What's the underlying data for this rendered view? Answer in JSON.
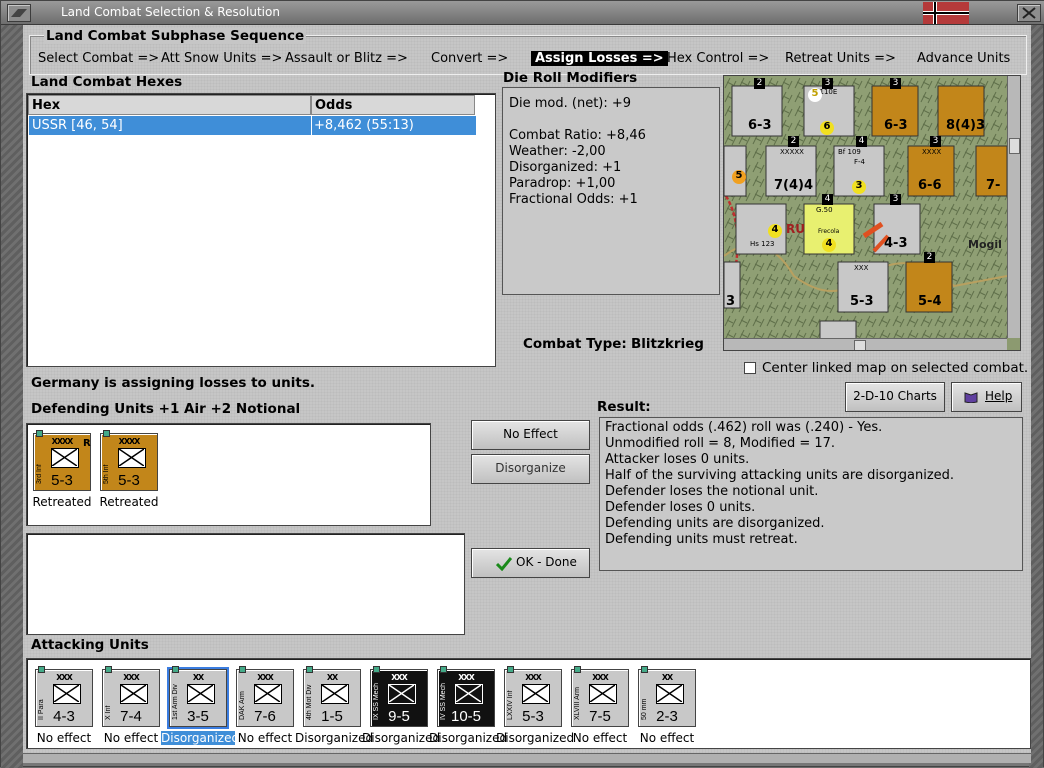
{
  "window": {
    "title": "Land Combat Selection & Resolution"
  },
  "sequence": {
    "title": "Land Combat Subphase Sequence",
    "steps": [
      {
        "label": "Select Combat =>"
      },
      {
        "label": "Att Snow Units =>"
      },
      {
        "label": "Assault or Blitz =>"
      },
      {
        "label": "Convert =>"
      },
      {
        "label": "Assign Losses =>"
      },
      {
        "label": "Hex Control =>"
      },
      {
        "label": "Retreat Units =>"
      },
      {
        "label": "Advance Units"
      }
    ]
  },
  "hexes": {
    "title": "Land Combat Hexes",
    "col_hex": "Hex",
    "col_odds": "Odds",
    "rows": [
      {
        "hex": "USSR [46, 54]",
        "odds": "+8,462 (55:13)"
      }
    ]
  },
  "die_roll": {
    "title": "Die Roll Modifiers",
    "lines": [
      "Die mod. (net): +9",
      "",
      "Combat Ratio: +8,46",
      "Weather: -2,00",
      "Disorganized: +1",
      "Paradrop: +1,00",
      "Fractional Odds: +1"
    ]
  },
  "combat_type": {
    "label": "Combat Type:",
    "value": "Blitzkrieg"
  },
  "map": {
    "center_checkbox_label": "Center linked map on selected combat.",
    "center_checked": false,
    "labels": [
      "RU",
      "Mogil",
      "Bf 110E",
      "Bf 109",
      "F-4",
      "G.50",
      "Frecola",
      "Hs 123",
      "XXXXX",
      "XXXX",
      "XXX"
    ],
    "strengths": [
      "6-3",
      "6-3",
      "8(4)3",
      "7(4)4",
      "6-6",
      "7-",
      "4-3",
      "5-3",
      "5-4",
      "3"
    ],
    "air_strengths": [
      "5",
      "6",
      "3",
      "5",
      "4",
      "4"
    ],
    "badges": [
      "2",
      "3",
      "3",
      "2",
      "4",
      "3",
      "4",
      "3",
      "2"
    ]
  },
  "status_text": "Germany is assigning losses to units.",
  "defending": {
    "title": "Defending Units +1 Air +2 Notional",
    "units": [
      {
        "name": "3rd Inf",
        "size": "XXXX",
        "str": "5-3",
        "status": "Retreated",
        "reserve": "R"
      },
      {
        "name": "5th Inf",
        "size": "XXXX",
        "str": "5-3",
        "status": "Retreated",
        "reserve": ""
      }
    ]
  },
  "buttons": {
    "no_effect": "No Effect",
    "disorganize": "Disorganize",
    "ok_done": "OK - Done",
    "charts": "2-D-10 Charts",
    "help": "Help"
  },
  "result": {
    "title": "Result:",
    "lines": [
      "Fractional odds (.462) roll was (.240)  - Yes.",
      "Unmodified roll = 8, Modified = 17.",
      "Attacker loses 0 units.",
      "Half of the surviving attacking units are disorganized.",
      "Defender loses the notional unit.",
      "Defender loses 0 units.",
      "Defending units are disorganized.",
      "Defending units must retreat."
    ]
  },
  "attacking": {
    "title": "Attacking Units",
    "units": [
      {
        "name": "II Para",
        "size": "XXX",
        "str": "4-3",
        "status": "No effect",
        "style": "grey",
        "selected": false
      },
      {
        "name": "X Inf",
        "size": "XXX",
        "str": "7-4",
        "status": "No effect",
        "style": "grey",
        "selected": false
      },
      {
        "name": "1st Arm Div",
        "size": "XX",
        "str": "3-5",
        "status": "Disorganized",
        "style": "grey",
        "selected": true
      },
      {
        "name": "DAK Arm",
        "size": "XXX",
        "str": "7-6",
        "status": "No effect",
        "style": "grey",
        "selected": false
      },
      {
        "name": "4th Mot Div",
        "size": "XX",
        "str": "1-5",
        "status": "Disorganized",
        "style": "grey",
        "selected": false
      },
      {
        "name": "IX SS Mech",
        "size": "XXX",
        "str": "9-5",
        "status": "Disorganized",
        "style": "black",
        "selected": false
      },
      {
        "name": "IV SS Mech",
        "size": "XXX",
        "str": "10-5",
        "status": "Disorganized",
        "style": "black",
        "selected": false
      },
      {
        "name": "LXXIV Inf",
        "size": "XXX",
        "str": "5-3",
        "status": "Disorganized",
        "style": "grey",
        "selected": false
      },
      {
        "name": "XLVIII Arm",
        "size": "XXX",
        "str": "7-5",
        "status": "No effect",
        "style": "grey",
        "selected": false
      },
      {
        "name": "50 mm",
        "size": "XX",
        "str": "2-3",
        "status": "No effect",
        "style": "grey",
        "selected": false
      }
    ]
  },
  "colors": {
    "selection": "#3f8ed8",
    "axis_orange": "#c2861a",
    "ss_black": "#111111"
  }
}
